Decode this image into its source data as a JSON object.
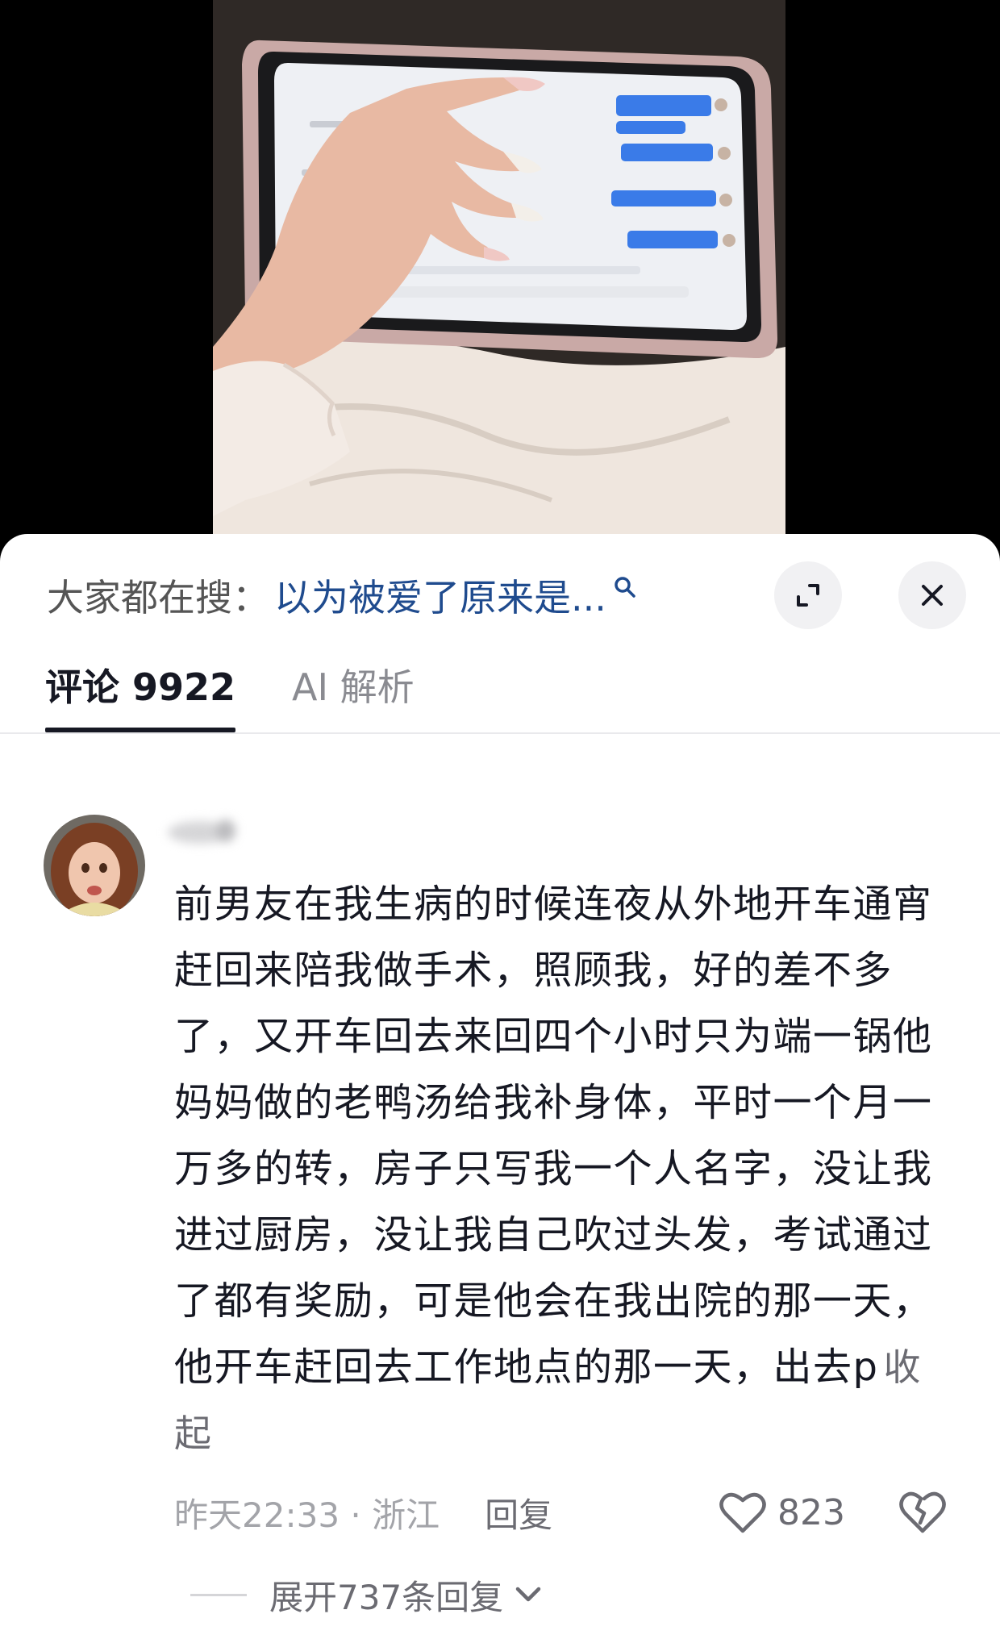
{
  "search": {
    "prefix": "大家都在搜：",
    "term": "以为被爱了原来是...",
    "icons": {
      "search": "search-icon",
      "expand": "expand-icon",
      "close": "close-icon"
    }
  },
  "tabs": [
    {
      "label": "评论 9922",
      "active": true
    },
    {
      "label": "AI 解析",
      "active": false
    }
  ],
  "comment": {
    "text": "前男友在我生病的时候连夜从外地开车通宵赶回来陪我做手术，照顾我，好的差不多了，又开车回去来回四个小时只为端一锅他妈妈做的老鸭汤给我补身体，平时一个月一万多的转，房子只写我一个人名字，没让我进过厨房，没让我自己吹过头发，考试通过了都有奖励，可是他会在我出院的那一天，他开车赶回去工作地点的那一天，出去p",
    "collapse_label": "收起",
    "time_location": "昨天22:33 · 浙江",
    "reply_label": "回复",
    "like_count": "823",
    "expand_replies_label": "展开737条回复"
  },
  "colors": {
    "accent_link": "#1f4b8e",
    "text_primary": "#161823",
    "text_secondary": "#a3a4a9"
  }
}
